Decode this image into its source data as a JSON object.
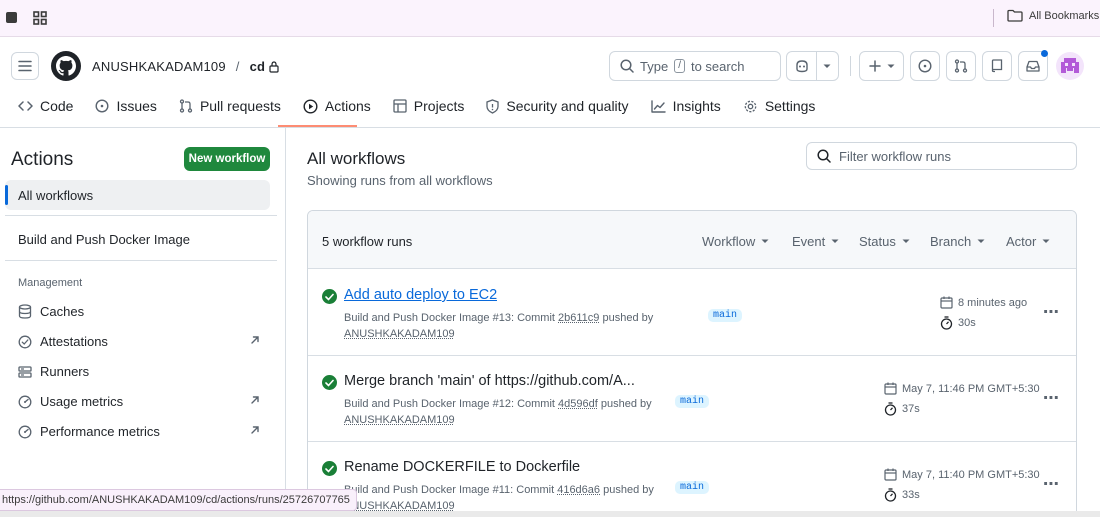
{
  "bookmarks": {
    "all_label": "All Bookmarks"
  },
  "header": {
    "owner": "ANUSHKAKADAM109",
    "separator": "/",
    "repo": "cd",
    "search_prefix": "Type",
    "search_key": "/",
    "search_suffix": "to search"
  },
  "tabs": [
    {
      "label": "Code"
    },
    {
      "label": "Issues"
    },
    {
      "label": "Pull requests"
    },
    {
      "label": "Actions"
    },
    {
      "label": "Projects"
    },
    {
      "label": "Security and quality"
    },
    {
      "label": "Insights"
    },
    {
      "label": "Settings"
    }
  ],
  "sidebar": {
    "title": "Actions",
    "new_workflow": "New workflow",
    "all_workflows": "All workflows",
    "workflow": "Build and Push Docker Image",
    "management_heading": "Management",
    "management": [
      {
        "label": "Caches"
      },
      {
        "label": "Attestations"
      },
      {
        "label": "Runners"
      },
      {
        "label": "Usage metrics"
      },
      {
        "label": "Performance metrics"
      }
    ]
  },
  "main": {
    "title": "All workflows",
    "subtitle": "Showing runs from all workflows",
    "filter_placeholder": "Filter workflow runs",
    "runs_count": "5 workflow runs",
    "filters": [
      {
        "label": "Workflow"
      },
      {
        "label": "Event"
      },
      {
        "label": "Status"
      },
      {
        "label": "Branch"
      },
      {
        "label": "Actor"
      }
    ],
    "runs": [
      {
        "title": "Add auto deploy to EC2",
        "workflow": "Build and Push Docker Image",
        "run_number": "#13:",
        "commit_word": "Commit",
        "commit": "2b611c9",
        "pushed_by": "pushed by",
        "actor": "ANUSHKAKADAM109",
        "branch": "main",
        "date": "8 minutes ago",
        "duration": "30s"
      },
      {
        "title": "Merge branch 'main' of https://github.com/A...",
        "workflow": "Build and Push Docker Image",
        "run_number": "#12:",
        "commit_word": "Commit",
        "commit": "4d596df",
        "pushed_by": "pushed by",
        "actor": "ANUSHKAKADAM109",
        "branch": "main",
        "date": "May 7, 11:46 PM GMT+5:30",
        "duration": "37s"
      },
      {
        "title": "Rename DOCKERFILE to Dockerfile",
        "workflow": "Build and Push Docker Image",
        "run_number": "#11:",
        "commit_word": "Commit",
        "commit": "416d6a6",
        "pushed_by": "pushed by",
        "actor": "ANUSHKAKADAM109",
        "branch": "main",
        "date": "May 7, 11:40 PM GMT+5:30",
        "duration": "33s"
      }
    ]
  },
  "status_url": "https://github.com/ANUSHKAKADAM109/cd/actions/runs/25726707765",
  "colors": {
    "accent": "#0969da",
    "success": "#1a7f37",
    "primary_button": "#1f883d",
    "tab_underline": "#fd8c73"
  }
}
